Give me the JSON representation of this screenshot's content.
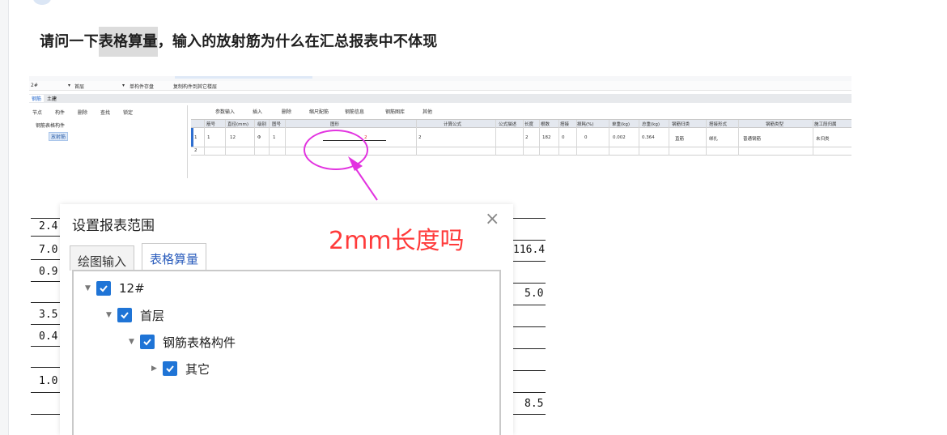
{
  "question": {
    "title_prefix": "请问一下",
    "title_highlight": "表格算量",
    "title_suffix": "，输入的放射筋为什么在汇总报表中不体现"
  },
  "software": {
    "floor_value": "2#",
    "layer_value": "首层",
    "toolbar_tabs": [
      "钢筋",
      "土建"
    ],
    "tool_save": "单构件存盘",
    "tool_copy": "复制构件到其它楼层",
    "left_tools": [
      "节点",
      "构件",
      "删除",
      "查找",
      "锁定"
    ],
    "tree_root": "钢筋表格构件",
    "tree_child": "放射筋",
    "grid_tools": [
      "参数输入",
      "插入",
      "删除",
      "缩尺配筋",
      "钢筋信息",
      "钢筋图库",
      "其他"
    ],
    "columns": [
      "筋号",
      "直径(mm)",
      "级别",
      "图号",
      "图形",
      "计算公式",
      "公式描述",
      "长度",
      "根数",
      "搭接",
      "损耗(%)",
      "单重(kg)",
      "总重(kg)",
      "钢筋归类",
      "搭接形式",
      "钢筋类型",
      "施工段归属"
    ],
    "row1": {
      "index": "1",
      "name": "1",
      "diameter": "12",
      "grade": "Φ",
      "figure_no": "1",
      "figure_value": "2",
      "formula": "2",
      "length": "2",
      "count": "182",
      "lap": "0",
      "loss": "0",
      "unit_weight": "0.002",
      "total_weight": "0.364",
      "category": "直筋",
      "lap_type": "绑扎",
      "rebar_type": "普通钢筋",
      "section": "未归类"
    },
    "row2_index": "2"
  },
  "annotation": "2mm长度吗",
  "dialog": {
    "title": "设置报表范围",
    "close_label": "×",
    "tabs": [
      "绘图输入",
      "表格算量"
    ],
    "active_tab": "表格算量",
    "tree": [
      {
        "label": "12#",
        "level": 0,
        "checked": true,
        "expanded": true
      },
      {
        "label": "首层",
        "level": 1,
        "checked": true,
        "expanded": true
      },
      {
        "label": "钢筋表格构件",
        "level": 2,
        "checked": true,
        "expanded": true
      },
      {
        "label": "其它",
        "level": 3,
        "checked": true,
        "expanded": false
      }
    ]
  },
  "background_doc": {
    "left_values": [
      "2.4",
      "7.0",
      "0.9",
      "3.5",
      "0.4",
      "1.0"
    ],
    "right_values": [
      "116.4",
      "5.0",
      "8.5"
    ]
  },
  "colors": {
    "checkbox": "#1f74d6",
    "annotation": "#ff3a3a",
    "circle": "#e233e0",
    "tab_active_text": "#2a5cbc"
  }
}
